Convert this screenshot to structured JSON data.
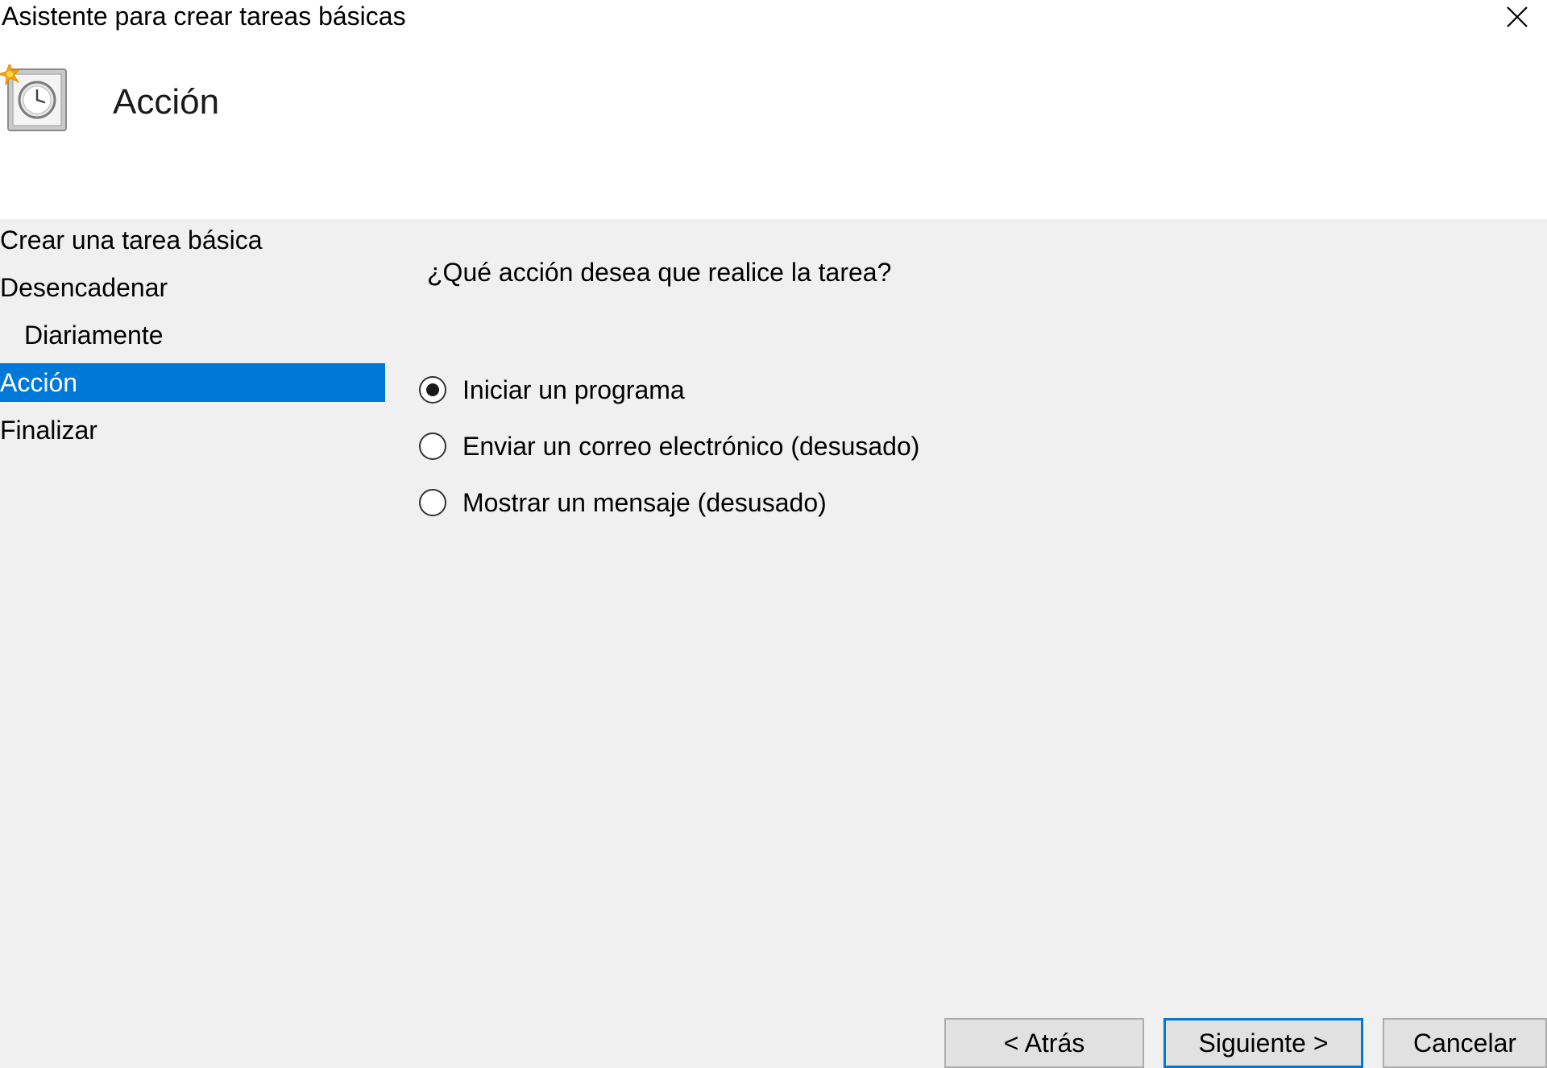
{
  "window": {
    "title": "Asistente para crear tareas básicas",
    "close_icon": "close-icon"
  },
  "header": {
    "icon": "task-scheduler-icon",
    "page_title": "Acción"
  },
  "steps": [
    {
      "label": "Crear una tarea básica"
    },
    {
      "label": "Desencadenar"
    },
    {
      "label": "Diariamente"
    },
    {
      "label": "Acción"
    },
    {
      "label": "Finalizar"
    }
  ],
  "main": {
    "question": "¿Qué acción desea que realice la tarea?",
    "options": [
      {
        "label": "Iniciar un programa",
        "checked": true
      },
      {
        "label": "Enviar un correo electrónico (desusado)",
        "checked": false
      },
      {
        "label": "Mostrar un mensaje (desusado)",
        "checked": false
      }
    ]
  },
  "buttons": {
    "back": "< Atrás",
    "next": "Siguiente >",
    "cancel": "Cancelar"
  },
  "colors": {
    "selection": "#0078d7",
    "header_bg": "#ffffff",
    "body_bg": "#f0f0f0"
  }
}
